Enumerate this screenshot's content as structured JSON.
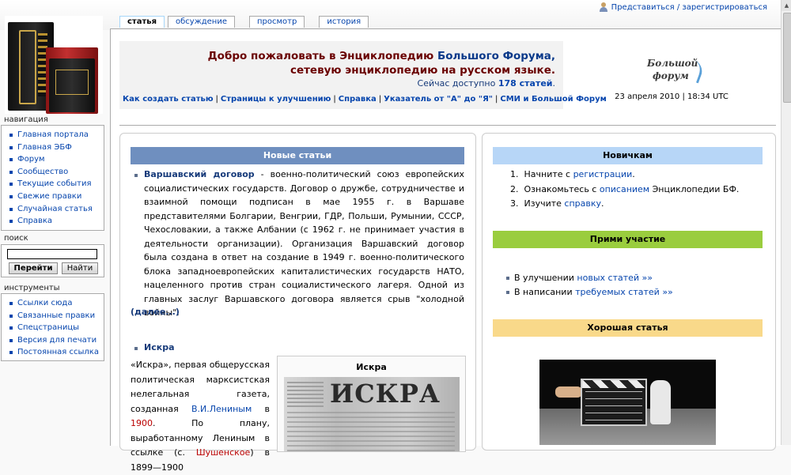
{
  "personal": {
    "login": "Представиться / зарегистрироваться"
  },
  "tabs": [
    "статья",
    "обсуждение",
    "просмотр",
    "история"
  ],
  "sidebar": {
    "nav_title": "навигация",
    "nav": [
      "Главная портала",
      "Главная ЭБФ",
      "Форум",
      "Сообщество",
      "Текущие события",
      "Свежие правки",
      "Случайная статья",
      "Справка"
    ],
    "search_title": "поиск",
    "search_go": "Перейти",
    "search_find": "Найти",
    "tools_title": "инструменты",
    "tools": [
      "Ссылки сюда",
      "Связанные правки",
      "Спецстраницы",
      "Версия для печати",
      "Постоянная ссылка"
    ]
  },
  "welcome": {
    "line1a": "Добро пожаловать в Энциклопедию ",
    "line1b": "Большого Форума,",
    "line2": "сетевую энциклопедию на русском языке.",
    "line3a": "Сейчас доступно ",
    "line3b": "178 статей",
    "line3c": ".",
    "links": [
      "Как создать статью",
      "Страницы к улучшению",
      "Справка",
      "Указатель от \"А\" до \"Я\"",
      "СМИ и Большой Форум"
    ],
    "separator": "|",
    "logo_line1": "Большой",
    "logo_line2": "форум",
    "date": "23 апреля 2010 | 18:34 UTC"
  },
  "new_articles": {
    "title": "Новые статьи",
    "article1_head": "Варшавский договор",
    "article1_text": " - военно-политический союз европейских социалистических государств. Договор о дружбе, сотрудничестве и взаимной помощи подписан в мае 1955 г. в Варшаве представителями Болгарии, Венгрии, ГДР, Польши, Румынии, СССР, Чехословакии, а также Албании (с 1962 г. не принимает участия в деятельности организации). Организация Варшавский договор была создана в ответ на создание в 1949 г. военно-политического блока западноевропейских капиталистических государств НАТО, нацеленного против стран социалистического лагеря. Одной из главных заслуг Варшавского договора является срыв \"холодной войны\".",
    "more": "(далее...)",
    "article2_head": "Искра",
    "article2_p1": "«Искра», первая общерусская политическая марксистская нелегальная газета, созданная ",
    "article2_link1": "В.И.Лениным",
    "article2_p2": " в ",
    "article2_link2": "1900",
    "article2_p3": ". По плану, выработанному Лениным в ссылке (с. ",
    "article2_link3": "Шушенское",
    "article2_p4": ") в 1899—1900",
    "image_caption": "Искра",
    "image_masthead": "ИСКРА"
  },
  "newbies": {
    "title": "Новичкам",
    "items": [
      {
        "num": "1.",
        "pre": "Начните с ",
        "link": "регистрации",
        "post": "."
      },
      {
        "num": "2.",
        "pre": "Ознакомьтесь с ",
        "link": "описанием",
        "post": " Энциклопедии БФ."
      },
      {
        "num": "3.",
        "pre": "Изучите ",
        "link": "справку",
        "post": "."
      }
    ]
  },
  "participate": {
    "title": "Прими участие",
    "items": [
      {
        "pre": "В улучшении ",
        "link": "новых статей »»"
      },
      {
        "pre": "В написании ",
        "link": "требуемых статей »»"
      }
    ]
  },
  "good_article": {
    "title": "Хорошая статья"
  },
  "colors": {
    "link": "#0645ad",
    "new_bar": "#6f8fbf",
    "newbie_bar": "#b7d6f7",
    "participate_bar": "#9acd3e",
    "good_bar": "#f9d98a"
  }
}
